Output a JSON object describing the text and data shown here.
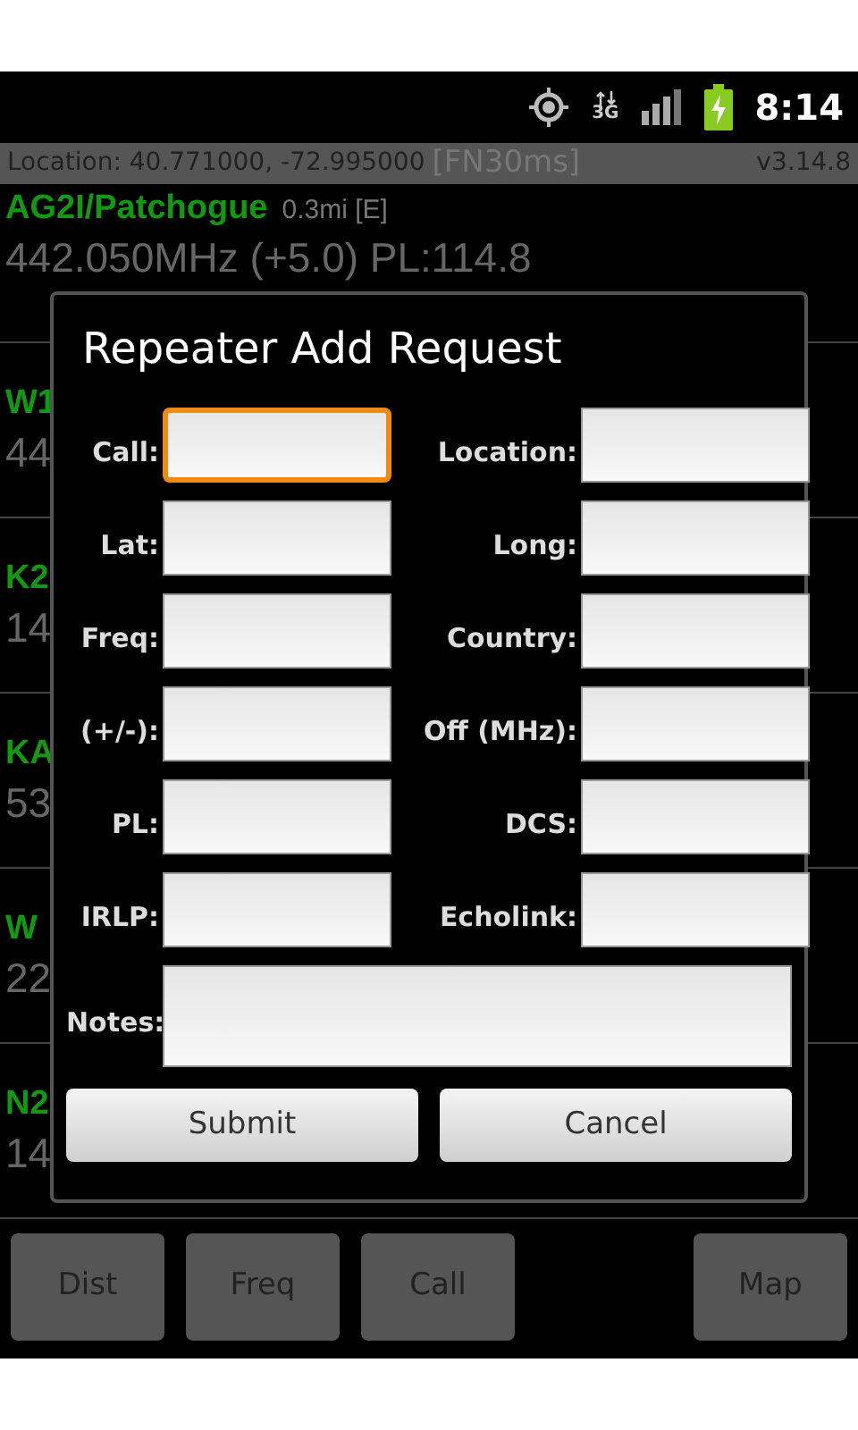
{
  "status_bar": {
    "network": "3G",
    "time": "8:14"
  },
  "info_bar": {
    "location": "Location: 40.771000, -72.995000",
    "grid": "[FN30ms]",
    "version": "v3.14.8"
  },
  "repeaters": [
    {
      "name": "AG2I/Patchogue",
      "distance": "0.3mi [E]",
      "details": "442.050MHz (+5.0) PL:114.8"
    },
    {
      "name": "W1",
      "details": "44"
    },
    {
      "name": "K2",
      "details": "14"
    },
    {
      "name": "KA",
      "details": "53"
    },
    {
      "name": "W",
      "details": "22"
    },
    {
      "name": "N2",
      "details": "14"
    }
  ],
  "dialog": {
    "title": "Repeater Add Request",
    "fields": [
      {
        "label": "Call:",
        "focused": true
      },
      {
        "label": "Location:",
        "focused": false
      },
      {
        "label": "Lat:",
        "focused": false
      },
      {
        "label": "Long:",
        "focused": false
      },
      {
        "label": "Freq:",
        "focused": false
      },
      {
        "label": "Country:",
        "focused": false
      },
      {
        "label": "(+/-):",
        "focused": false
      },
      {
        "label": "Off (MHz):",
        "focused": false
      },
      {
        "label": "PL:",
        "focused": false
      },
      {
        "label": "DCS:",
        "focused": false
      },
      {
        "label": "IRLP:",
        "focused": false
      },
      {
        "label": "Echolink:",
        "focused": false
      }
    ],
    "notes": {
      "label": "Notes:"
    },
    "buttons": [
      "Submit",
      "Cancel"
    ]
  },
  "sort_buttons": [
    "Dist",
    "Freq",
    "Call"
  ],
  "map_button": "Map"
}
